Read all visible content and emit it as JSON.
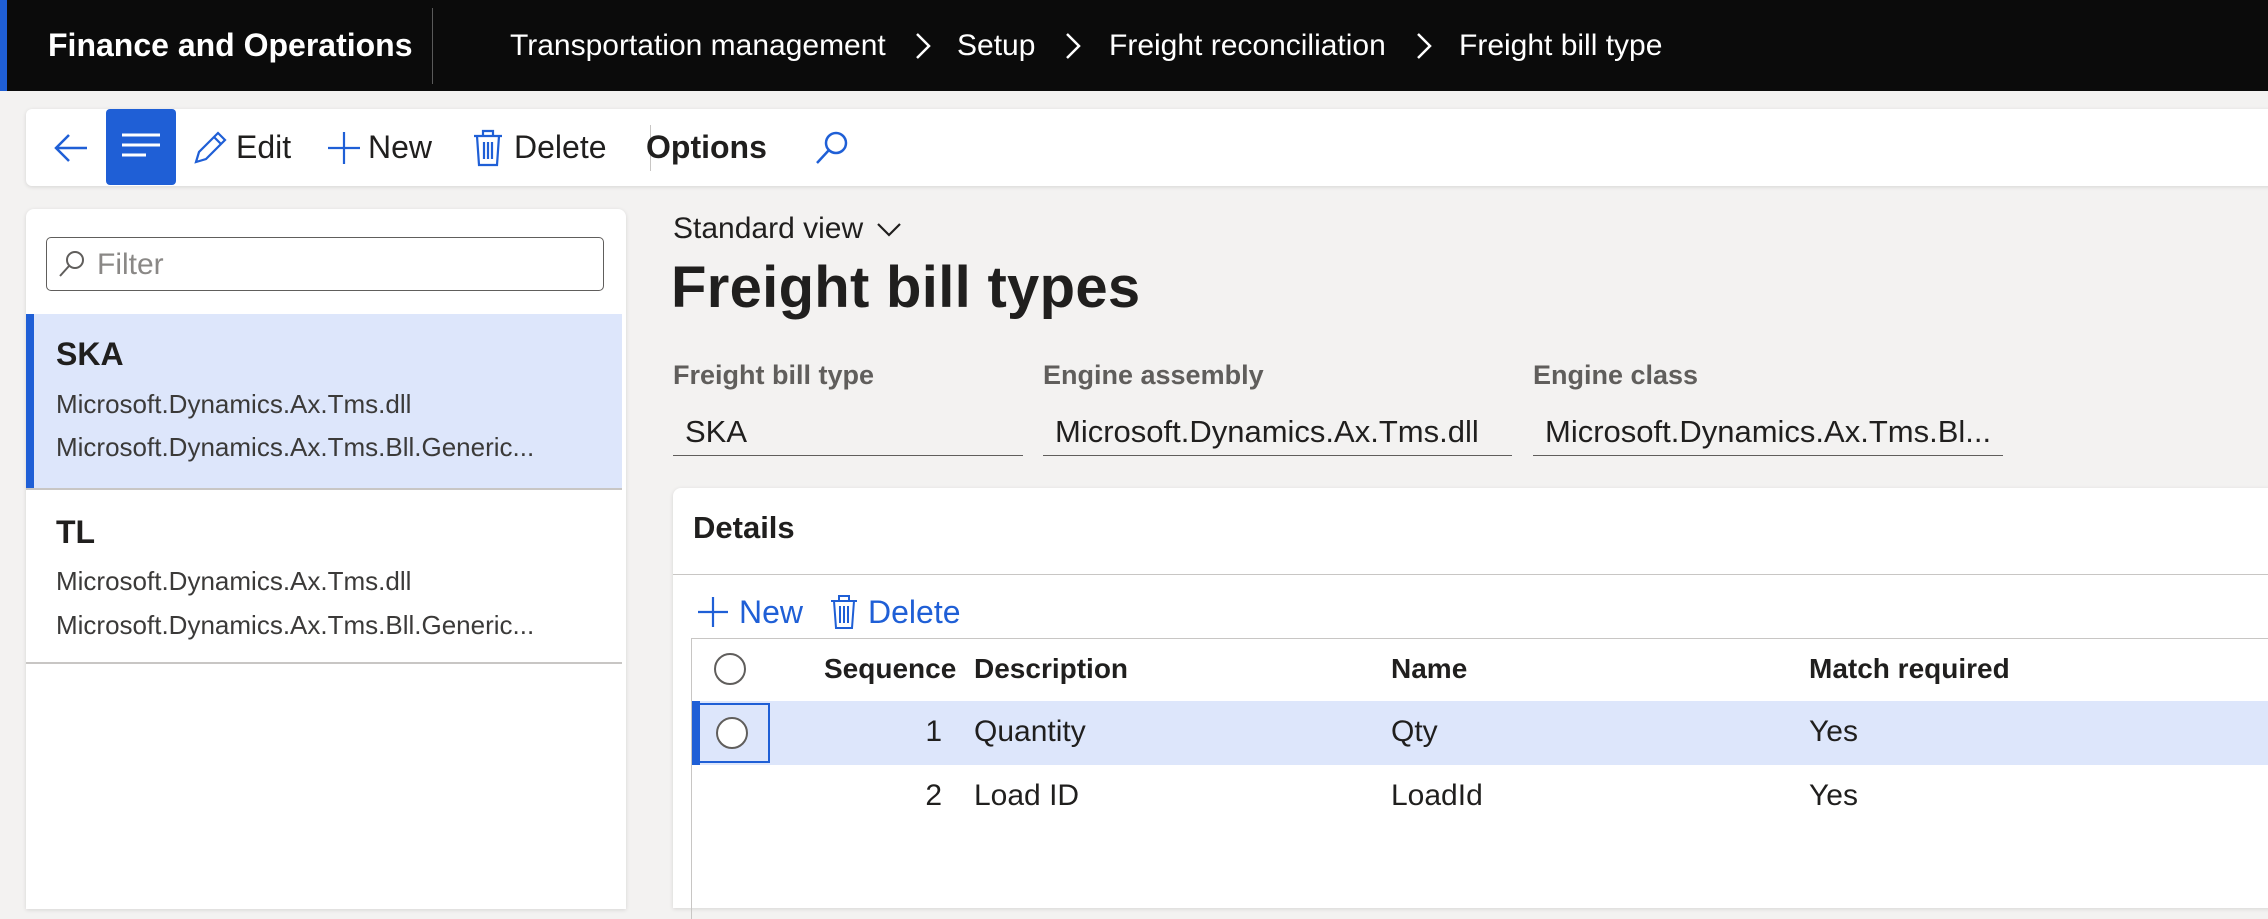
{
  "app": {
    "title": "Finance and Operations"
  },
  "breadcrumb": [
    "Transportation management",
    "Setup",
    "Freight reconciliation",
    "Freight bill type"
  ],
  "toolbar": {
    "edit_label": "Edit",
    "new_label": "New",
    "delete_label": "Delete",
    "options_label": "Options"
  },
  "filter": {
    "placeholder": "Filter",
    "value": ""
  },
  "list": [
    {
      "code": "SKA",
      "assembly": "Microsoft.Dynamics.Ax.Tms.dll",
      "class": "Microsoft.Dynamics.Ax.Tms.Bll.Generic..."
    },
    {
      "code": "TL",
      "assembly": "Microsoft.Dynamics.Ax.Tms.dll",
      "class": "Microsoft.Dynamics.Ax.Tms.Bll.Generic..."
    }
  ],
  "main": {
    "view_label": "Standard view",
    "title": "Freight bill types",
    "fields": [
      {
        "label": "Freight bill type",
        "value": "SKA"
      },
      {
        "label": "Engine assembly",
        "value": "Microsoft.Dynamics.Ax.Tms.dll"
      },
      {
        "label": "Engine class",
        "value": "Microsoft.Dynamics.Ax.Tms.Bl..."
      }
    ]
  },
  "details": {
    "title": "Details",
    "new_label": "New",
    "delete_label": "Delete",
    "columns": [
      "Sequence",
      "Description",
      "Name",
      "Match required"
    ],
    "rows": [
      {
        "sequence": "1",
        "description": "Quantity",
        "name": "Qty",
        "match": "Yes"
      },
      {
        "sequence": "2",
        "description": "Load ID",
        "name": "LoadId",
        "match": "Yes"
      }
    ]
  },
  "colors": {
    "accent": "#1f5fd6",
    "topbar": "#0b0b0b",
    "selected_row": "#dde6fb"
  }
}
